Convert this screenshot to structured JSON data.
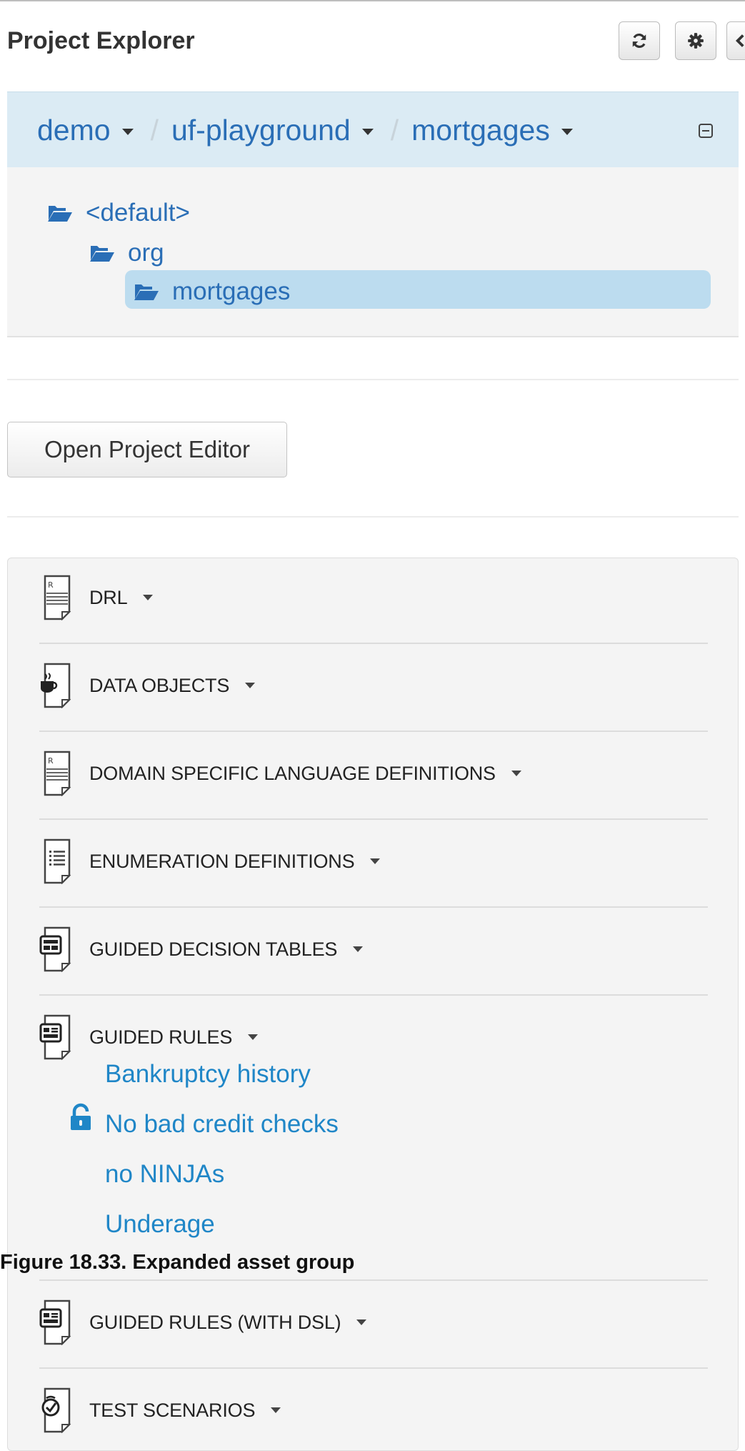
{
  "header": {
    "title": "Project Explorer",
    "buttons": [
      {
        "icon": "refresh-icon"
      },
      {
        "icon": "gear-icon"
      },
      {
        "icon": "chevron-left-icon"
      }
    ]
  },
  "breadcrumb": {
    "items": [
      "demo",
      "uf-playground",
      "mortgages"
    ],
    "separator": "/",
    "collapse_icon": "collapse-icon"
  },
  "tree": {
    "nodes": [
      {
        "label": "<default>",
        "level": 0,
        "selected": false
      },
      {
        "label": "org",
        "level": 1,
        "selected": false
      },
      {
        "label": "mortgages",
        "level": 2,
        "selected": true
      }
    ]
  },
  "actions": {
    "open_project_editor": "Open Project Editor"
  },
  "asset_groups": [
    {
      "label": "DRL",
      "icon": "drl-file-icon"
    },
    {
      "label": "DATA OBJECTS",
      "icon": "data-object-file-icon"
    },
    {
      "label": "DOMAIN SPECIFIC LANGUAGE DEFINITIONS",
      "icon": "dsl-file-icon"
    },
    {
      "label": "ENUMERATION DEFINITIONS",
      "icon": "enumeration-file-icon"
    },
    {
      "label": "GUIDED DECISION TABLES",
      "icon": "decision-table-file-icon"
    },
    {
      "label": "GUIDED RULES",
      "icon": "guided-rule-file-icon",
      "expanded": true,
      "assets": [
        {
          "label": "Bankruptcy history",
          "locked": false
        },
        {
          "label": "No bad credit checks",
          "locked": true
        },
        {
          "label": "no NINJAs",
          "locked": false
        },
        {
          "label": "Underage",
          "locked": false
        }
      ]
    },
    {
      "label": "GUIDED RULES (WITH DSL)",
      "icon": "guided-rule-dsl-file-icon"
    },
    {
      "label": "TEST SCENARIOS",
      "icon": "test-scenario-file-icon"
    }
  ],
  "caption": "Figure 18.33. Expanded asset group",
  "colors": {
    "link": "#2a6eb6",
    "asset_link": "#1f86c7",
    "breadcrumb_bg": "#dbebf4",
    "selected_bg": "#bcdcef",
    "panel_bg": "#f4f4f4"
  }
}
